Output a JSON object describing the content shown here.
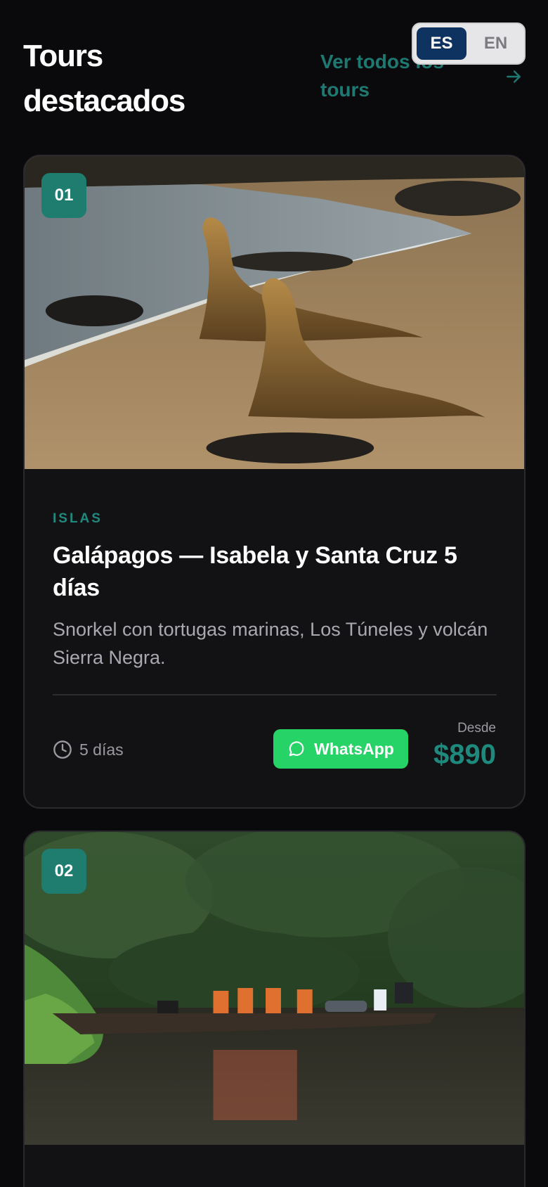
{
  "header": {
    "title": "Tours destacados",
    "view_all_label": "Ver todos los tours"
  },
  "language": {
    "options": [
      "ES",
      "EN"
    ],
    "selected": "ES"
  },
  "colors": {
    "accent": "#1e8a7d",
    "whatsapp": "#25d366",
    "lang_active": "#0f3360"
  },
  "tours": [
    {
      "number": "01",
      "category": "ISLAS",
      "title": "Galápagos — Isabela y Santa Cruz 5 días",
      "description": "Snorkel con tortugas marinas, Los Túneles y volcán Sierra Negra.",
      "duration": "5 días",
      "cta_label": "WhatsApp",
      "price_label": "Desde",
      "price": "$890",
      "image_icon": "sea-lions-beach-photo"
    },
    {
      "number": "02",
      "image_icon": "jungle-river-canoe-photo"
    }
  ]
}
